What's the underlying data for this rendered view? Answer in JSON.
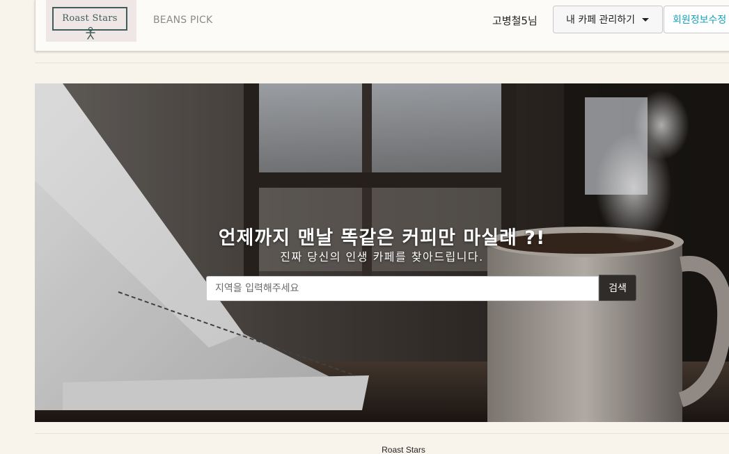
{
  "header": {
    "logo_text": "Roast Stars",
    "brand_link": "BEANS PICK",
    "user_name": "고병철5님",
    "cafe_menu_label": "내 카페 관리하기",
    "profile_edit_label": "회원정보수정"
  },
  "hero": {
    "title": "언제까지 맨날 똑같은 커피만 마실래 ?!",
    "subtitle": "진짜 당신의 인생 카페를 찾아드립니다.",
    "search_placeholder": "지역을 입력해주세요",
    "search_value": "",
    "search_button_label": "검색"
  },
  "footer": {
    "text": "Roast Stars"
  },
  "colors": {
    "page_bg": "#f8f4ec",
    "accent_link": "#17a2b8",
    "logo_ink": "#3e5c5a"
  },
  "icons": {
    "dropdown": "caret-down-icon",
    "logo": "gingerbread-figure-icon"
  }
}
